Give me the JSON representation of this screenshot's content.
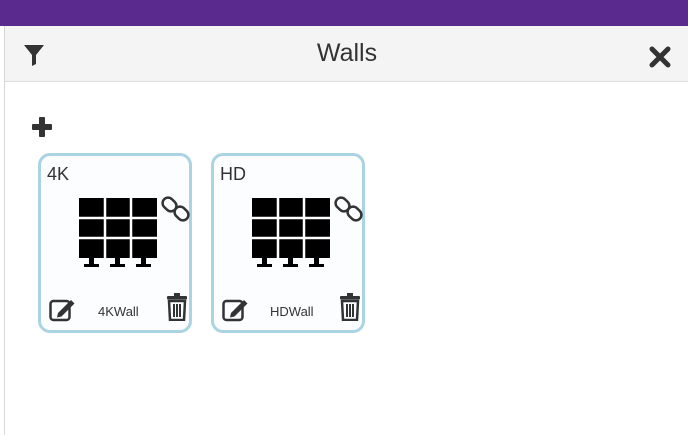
{
  "header": {
    "title": "Walls",
    "filter_icon": "filter-icon",
    "close_icon": "close-icon"
  },
  "toolbar": {
    "add_icon": "plus-icon"
  },
  "walls": [
    {
      "label": "4K",
      "name": "4KWall"
    },
    {
      "label": "HD",
      "name": "HDWall"
    }
  ],
  "colors": {
    "topbar": "#5a2a8e",
    "card_border": "#aad3e3",
    "header_bg": "#f4f4f4",
    "icon": "#333333"
  }
}
